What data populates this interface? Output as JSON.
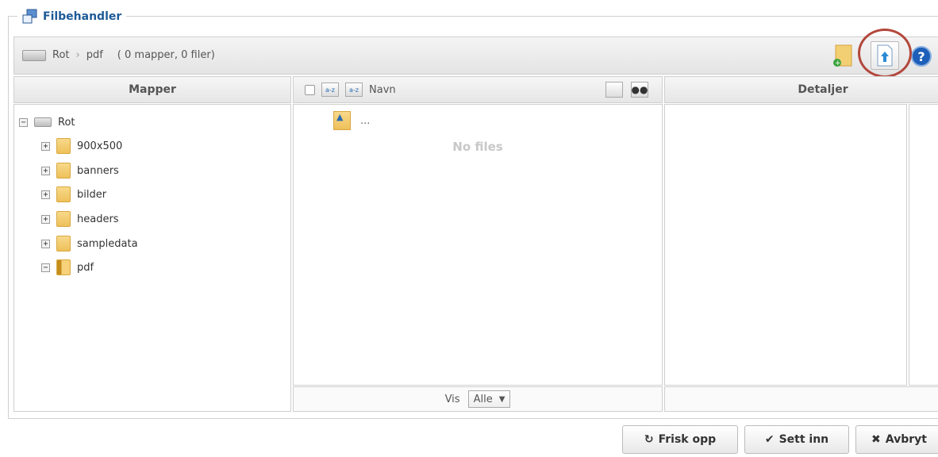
{
  "fieldset": {
    "title": "Filbehandler"
  },
  "toolbar": {
    "path": [
      "Rot",
      "pdf"
    ],
    "separator": "›",
    "counts": "( 0 mapper, 0 filer)"
  },
  "columns": {
    "mapper": "Mapper",
    "name": "Navn",
    "details": "Detaljer"
  },
  "tree": {
    "root": "Rot",
    "folders": [
      {
        "name": "900x500",
        "toggle": "+"
      },
      {
        "name": "banners",
        "toggle": "+"
      },
      {
        "name": "bilder",
        "toggle": "+"
      },
      {
        "name": "headers",
        "toggle": "+"
      },
      {
        "name": "sampledata",
        "toggle": "+"
      },
      {
        "name": "pdf",
        "toggle": "−"
      }
    ],
    "root_toggle": "−"
  },
  "files": {
    "up_label": "...",
    "empty": "No files"
  },
  "footer": {
    "show_label": "Vis",
    "show_value": "Alle",
    "show_arrow": "▼"
  },
  "buttons": {
    "refresh": "Frisk opp",
    "insert": "Sett inn",
    "cancel": "Avbryt",
    "refresh_icon": "↻",
    "insert_icon": "✔",
    "cancel_icon": "✖",
    "help": "?"
  },
  "colors": {
    "accent": "#1e5b97",
    "highlight": "#b3473c"
  }
}
